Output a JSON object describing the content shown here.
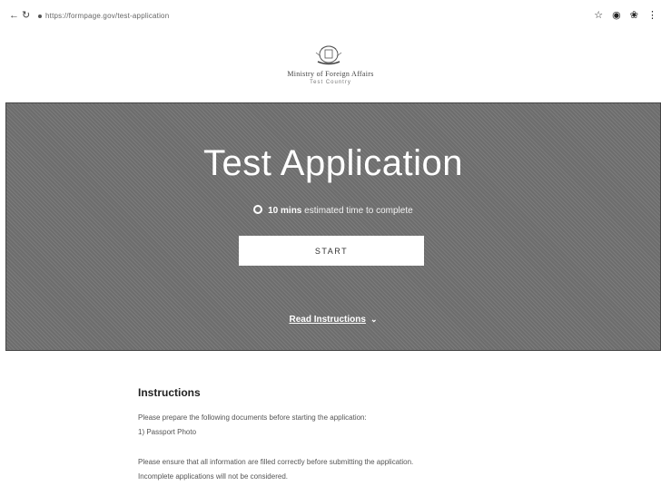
{
  "browser": {
    "url": "https://formpage.gov/test-application",
    "back_icon": "arrow-left-icon",
    "reload_icon": "reload-icon",
    "bar_icons": [
      "star-icon",
      "extension-icon",
      "profile-icon"
    ]
  },
  "header": {
    "ministry": "Ministry of Foreign Affairs",
    "country": "Test Country"
  },
  "hero": {
    "title": "Test Application",
    "time_value": "10 mins",
    "time_suffix": "estimated time to complete",
    "start_label": "START",
    "read_label": "Read Instructions"
  },
  "instructions": {
    "heading": "Instructions",
    "line1": "Please prepare the following documents before starting the application:",
    "line2": "1) Passport Photo",
    "line3": "Please ensure that all information are filled correctly before submitting the application.",
    "line4": "Incomplete applications will not be considered."
  },
  "colors": {
    "hero_bg": "#6d6d6d",
    "button_bg": "#ffffff"
  }
}
